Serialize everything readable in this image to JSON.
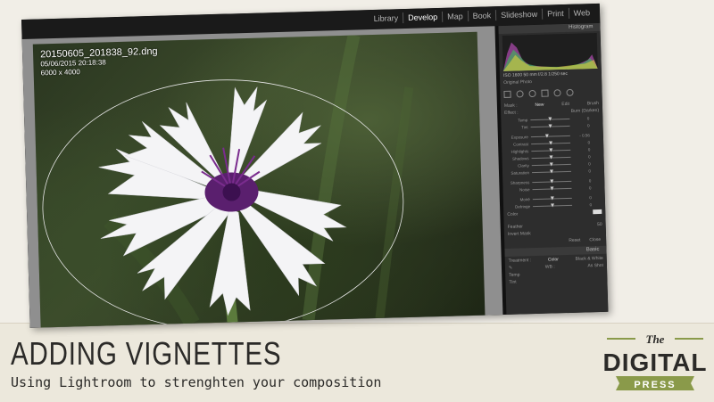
{
  "screenshot": {
    "modules": [
      "Library",
      "Develop",
      "Map",
      "Book",
      "Slideshow",
      "Print",
      "Web"
    ],
    "active_module": "Develop",
    "photo": {
      "filename": "20150605_201838_92.dng",
      "datetime": "05/06/2015 20:18:38",
      "dimensions": "6000 x 4000"
    },
    "panel": {
      "histogram_label": "Histogram",
      "histogram_values": "ISO 1600  50 mm  f/2.8  1/250 sec",
      "original_photo": "Original Photo",
      "mask_label": "Mask :",
      "mask_new": "New",
      "mask_edit": "Edit",
      "mask_brush": "Brush",
      "effect_label": "Effect :",
      "effect_value": "Burn (Darken)",
      "sliders": [
        {
          "label": "Temp",
          "value": "0",
          "pos": 0.5
        },
        {
          "label": "Tint",
          "value": "0",
          "pos": 0.5
        },
        {
          "label": "Exposure",
          "value": "- 0.56",
          "pos": 0.4
        },
        {
          "label": "Contrast",
          "value": "0",
          "pos": 0.5
        },
        {
          "label": "Highlights",
          "value": "0",
          "pos": 0.5
        },
        {
          "label": "Shadows",
          "value": "0",
          "pos": 0.5
        },
        {
          "label": "Clarity",
          "value": "0",
          "pos": 0.5
        },
        {
          "label": "Saturation",
          "value": "0",
          "pos": 0.5
        },
        {
          "label": "Sharpness",
          "value": "0",
          "pos": 0.5
        },
        {
          "label": "Noise",
          "value": "0",
          "pos": 0.5
        },
        {
          "label": "Moiré",
          "value": "0",
          "pos": 0.5
        },
        {
          "label": "Defringe",
          "value": "0",
          "pos": 0.5
        }
      ],
      "color_label": "Color",
      "feather_label": "Feather",
      "feather_value": "50",
      "invert_mask": "Invert Mask",
      "reset": "Reset",
      "close": "Close",
      "basic_label": "Basic",
      "treatment_label": "Treatment :",
      "treatment_color": "Color",
      "treatment_bw": "Black & White",
      "wb_label": "WB :",
      "wb_value": "As Shot",
      "temp_label": "Temp",
      "tint_label": "Tint"
    }
  },
  "title": "ADDING VIGNETTES",
  "subtitle": "Using Lightroom to strenghten your composition",
  "logo": {
    "the": "The",
    "digital": "DIGITAL",
    "press": "PRESS"
  },
  "colors": {
    "logo_green": "#8a9a4a",
    "text_dark": "#2b2a28",
    "paper": "#efece4"
  }
}
